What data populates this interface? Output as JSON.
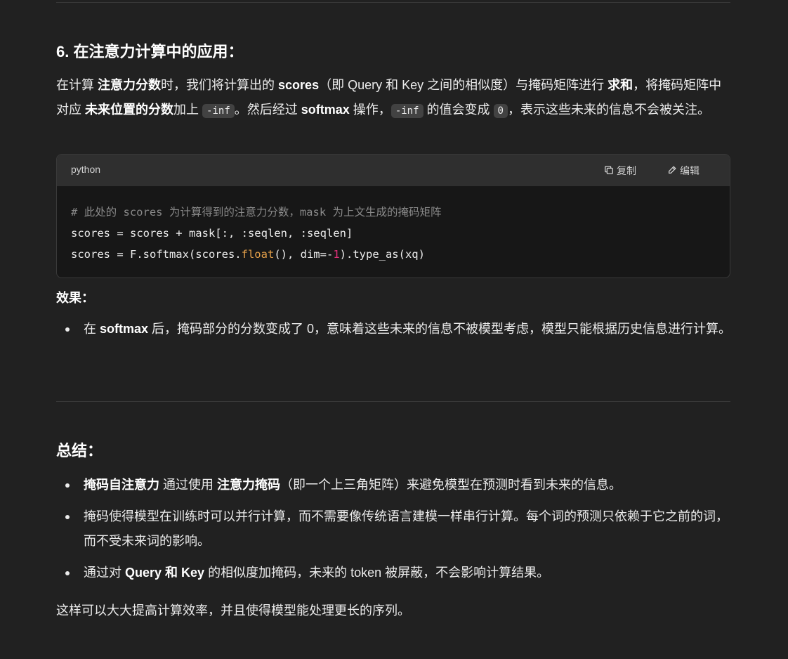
{
  "section6": {
    "heading": "6. 在注意力计算中的应用：",
    "para": {
      "t1": "在计算 ",
      "b1": "注意力分数",
      "t2": "时，我们将计算出的 ",
      "b2": "scores",
      "t3": "（即 Query 和 Key 之间的相似度）与掩码矩阵进行 ",
      "b3": "求和",
      "t4": "，将掩码矩阵中对应 ",
      "b4": "未来位置的分数",
      "t5": "加上 ",
      "c1": "-inf",
      "t6": "。然后经过 ",
      "b5": "softmax",
      "t7": " 操作，",
      "c2": "-inf",
      "t8": " 的值会变成 ",
      "c3": "0",
      "t9": "，表示这些未来的信息不会被关注。"
    }
  },
  "code_block": {
    "language": "python",
    "copy_label": "复制",
    "edit_label": "编辑",
    "comment_line": "# 此处的 scores 为计算得到的注意力分数，mask 为上文生成的掩码矩阵",
    "line2": "scores = scores + mask[:, :seqlen, :seqlen]",
    "line3_a": "scores = F.softmax(scores.",
    "line3_float": "float",
    "line3_b": "(), dim=-",
    "line3_num": "1",
    "line3_c": ").type_as(xq)"
  },
  "effect": {
    "label": "效果：",
    "items": [
      {
        "t1": "在 ",
        "b1": "softmax",
        "t2": " 后，掩码部分的分数变成了 0，意味着这些未来的信息不被模型考虑，模型只能根据历史信息进行计算。"
      }
    ]
  },
  "summary": {
    "heading": "总结：",
    "item1": {
      "b1": "掩码自注意力",
      "t1": " 通过使用 ",
      "b2": "注意力掩码",
      "t2": "（即一个上三角矩阵）来避免模型在预测时看到未来的信息。"
    },
    "item2": {
      "t1": "掩码使得模型在训练时可以并行计算，而不需要像传统语言建模一样串行计算。每个词的预测只依赖于它之前的词，而不受未来词的影响。"
    },
    "item3": {
      "t1": "通过对 ",
      "b1": "Query 和 Key",
      "t2": " 的相似度加掩码，未来的 token 被屏蔽，不会影响计算结果。"
    },
    "closing": "这样可以大大提高计算效率，并且使得模型能处理更长的序列。"
  },
  "colors": {
    "background": "#212121",
    "code_header": "#2f2f2f",
    "code_body": "#171717",
    "keyword_orange": "#e5a04a",
    "number_pink": "#df3079"
  }
}
